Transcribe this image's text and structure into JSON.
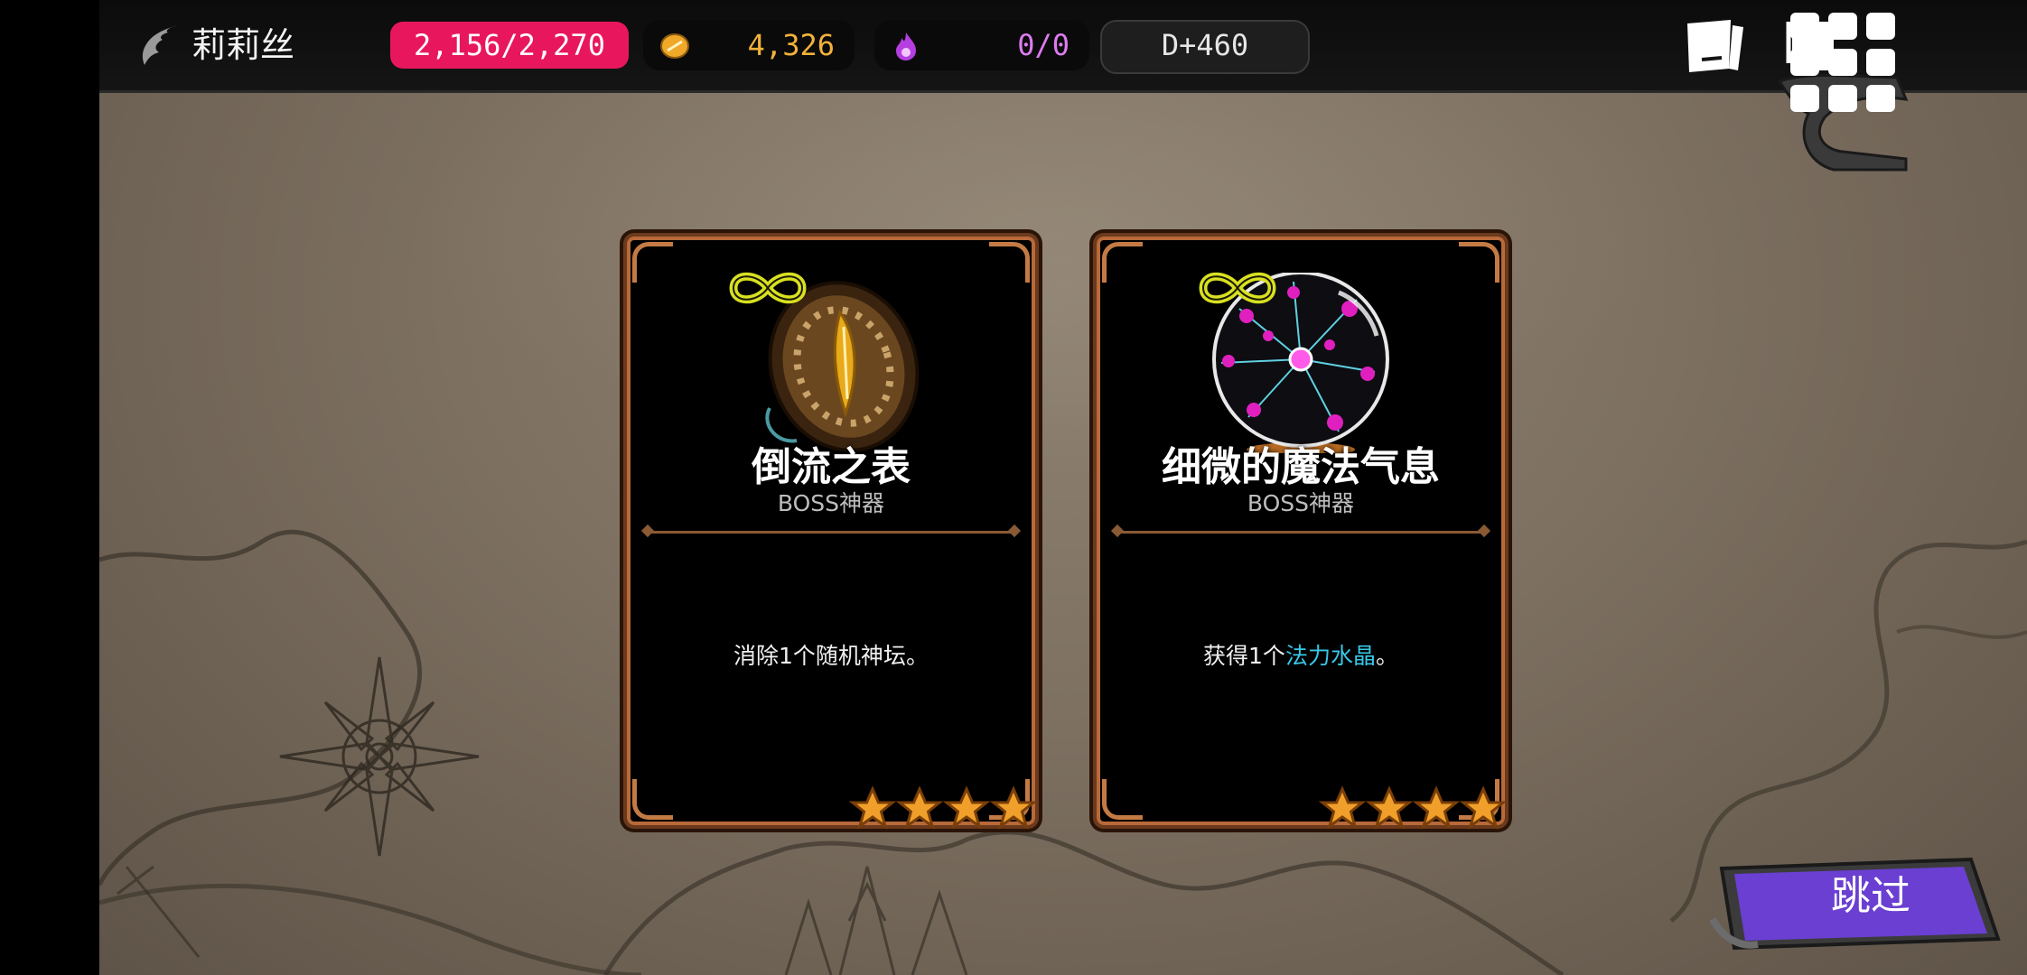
{
  "header": {
    "character_name": "莉莉丝",
    "hp": "2,156/2,270",
    "gold": "4,326",
    "soul": "0/0",
    "day": "D+460"
  },
  "cards": [
    {
      "title": "倒流之表",
      "subtitle": "BOSS神器",
      "desc_before": "消除1个随机神坛。",
      "desc_highlight": "",
      "desc_after": "",
      "stars": 4,
      "icon": "clock-icon"
    },
    {
      "title": "细微的魔法气息",
      "subtitle": "BOSS神器",
      "desc_before": "获得1个",
      "desc_highlight": "法力水晶",
      "desc_after": "。",
      "stars": 4,
      "icon": "plasma-orb-icon"
    }
  ],
  "skip_button": {
    "label": "跳过"
  },
  "colors": {
    "hp_pill": "#e8175d",
    "gold_text": "#f2b23a",
    "soul_text": "#dd7cf0",
    "highlight_text": "#38c8e8",
    "skip_button": "#6a3fd1",
    "card_border": "#b86a3a"
  }
}
